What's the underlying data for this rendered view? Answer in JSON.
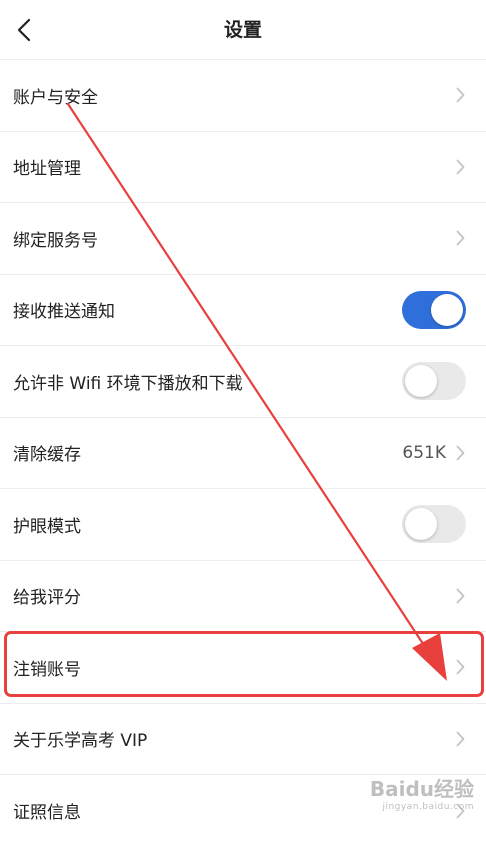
{
  "header": {
    "title": "设置",
    "back_icon": "chevron-left-icon"
  },
  "settings": [
    {
      "label": "账户与安全",
      "control": "chevron"
    },
    {
      "label": "地址管理",
      "control": "chevron"
    },
    {
      "label": "绑定服务号",
      "control": "chevron"
    },
    {
      "label": "接收推送通知",
      "control": "toggle",
      "state": "on"
    },
    {
      "label": "允许非 Wifi 环境下播放和下载",
      "control": "toggle",
      "state": "off"
    },
    {
      "label": "清除缓存",
      "control": "chevron",
      "value": "651K"
    },
    {
      "label": "护眼模式",
      "control": "toggle",
      "state": "off"
    },
    {
      "label": "给我评分",
      "control": "chevron"
    },
    {
      "label": "注销账号",
      "control": "chevron"
    },
    {
      "label": "关于乐学高考 VIP",
      "control": "chevron"
    },
    {
      "label": "证照信息",
      "control": "chevron"
    }
  ],
  "annotation": {
    "highlighted_item": "注销账号",
    "color": "#e8403c"
  },
  "watermark": {
    "main": "Baidu经验",
    "sub": "jingyan.baidu.com"
  },
  "colors": {
    "toggle_on": "#2f6fdc",
    "toggle_off": "#e9e9e9",
    "chevron": "#c4c4c4",
    "divider": "#ececec"
  }
}
